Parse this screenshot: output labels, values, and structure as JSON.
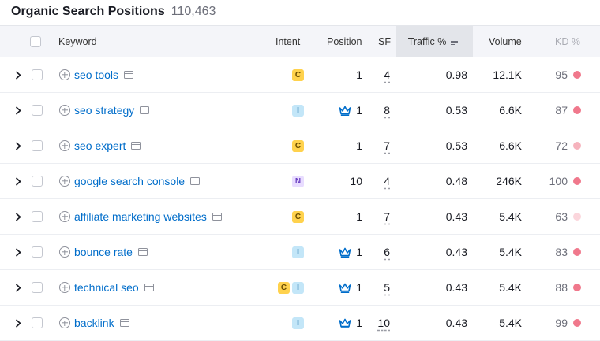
{
  "header": {
    "title": "Organic Search Positions",
    "count": "110,463"
  },
  "columns": {
    "keyword": "Keyword",
    "intent": "Intent",
    "position": "Position",
    "sf": "SF",
    "traffic": "Traffic %",
    "volume": "Volume",
    "kd": "KD %"
  },
  "rows": [
    {
      "keyword": "seo tools",
      "intent": [
        "C"
      ],
      "crown": false,
      "position": "1",
      "sf": "4",
      "traffic": "0.98",
      "volume": "12.1K",
      "kd": "95",
      "kd_color": "#f0788c"
    },
    {
      "keyword": "seo strategy",
      "intent": [
        "I"
      ],
      "crown": true,
      "position": "1",
      "sf": "8",
      "traffic": "0.53",
      "volume": "6.6K",
      "kd": "87",
      "kd_color": "#f0788c"
    },
    {
      "keyword": "seo expert",
      "intent": [
        "C"
      ],
      "crown": false,
      "position": "1",
      "sf": "7",
      "traffic": "0.53",
      "volume": "6.6K",
      "kd": "72",
      "kd_color": "#f6b3bd"
    },
    {
      "keyword": "google search console",
      "intent": [
        "N"
      ],
      "crown": false,
      "position": "10",
      "sf": "4",
      "traffic": "0.48",
      "volume": "246K",
      "kd": "100",
      "kd_color": "#f0788c"
    },
    {
      "keyword": "affiliate marketing websites",
      "intent": [
        "C"
      ],
      "crown": false,
      "position": "1",
      "sf": "7",
      "traffic": "0.43",
      "volume": "5.4K",
      "kd": "63",
      "kd_color": "#fbd6dc"
    },
    {
      "keyword": "bounce rate",
      "intent": [
        "I"
      ],
      "crown": true,
      "position": "1",
      "sf": "6",
      "traffic": "0.43",
      "volume": "5.4K",
      "kd": "83",
      "kd_color": "#f0788c"
    },
    {
      "keyword": "technical seo",
      "intent": [
        "C",
        "I"
      ],
      "crown": true,
      "position": "1",
      "sf": "5",
      "traffic": "0.43",
      "volume": "5.4K",
      "kd": "88",
      "kd_color": "#f0788c"
    },
    {
      "keyword": "backlink",
      "intent": [
        "I"
      ],
      "crown": true,
      "position": "1",
      "sf": "10",
      "traffic": "0.43",
      "volume": "5.4K",
      "kd": "99",
      "kd_color": "#f0788c"
    }
  ],
  "colors": {
    "link": "#006dca",
    "intent_commercial": "#ffd24d",
    "intent_informational": "#c3e6f8",
    "intent_navigational": "#e8dcff",
    "crown": "#006dca"
  },
  "icons": {
    "expand": "chevron-right-icon",
    "add": "plus-circle-icon",
    "serp": "serp-snapshot-icon",
    "crown": "crown-icon",
    "sort": "sort-descending-icon"
  }
}
